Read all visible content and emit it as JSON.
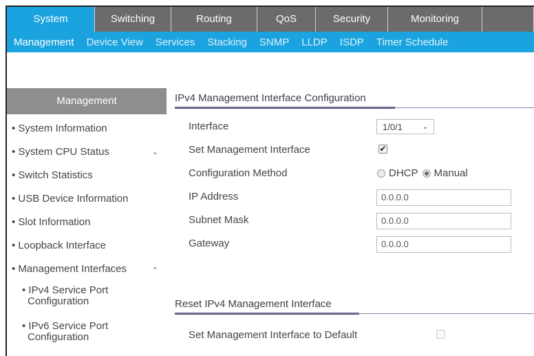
{
  "top_tabs": [
    "System",
    "Switching",
    "Routing",
    "QoS",
    "Security",
    "Monitoring",
    ""
  ],
  "sub_tabs": [
    "Management",
    "Device View",
    "Services",
    "Stacking",
    "SNMP",
    "LLDP",
    "ISDP",
    "Timer Schedule"
  ],
  "sidebar": {
    "header": "Management",
    "items": [
      "• System Information",
      "• System CPU Status",
      "• Switch Statistics",
      "• USB Device Information",
      "• Slot Information",
      "• Loopback Interface",
      "• Management Interfaces"
    ],
    "subitems": [
      [
        "• IPv4 Service Port",
        "Configuration"
      ],
      [
        "• IPv6 Service Port",
        "Configuration"
      ]
    ]
  },
  "section1": {
    "title": "IPv4 Management Interface Configuration",
    "interface_label": "Interface",
    "interface_value": "1/0/1",
    "set_mgmt_label": "Set Management Interface",
    "config_method_label": "Configuration Method",
    "dhcp_label": "DHCP",
    "manual_label": "Manual",
    "ip_label": "IP Address",
    "ip_value": "0.0.0.0",
    "subnet_label": "Subnet Mask",
    "subnet_value": "0.0.0.0",
    "gateway_label": "Gateway",
    "gateway_value": "0.0.0.0"
  },
  "section2": {
    "title": "Reset IPv4 Management Interface",
    "default_label": "Set Management Interface to Default"
  }
}
